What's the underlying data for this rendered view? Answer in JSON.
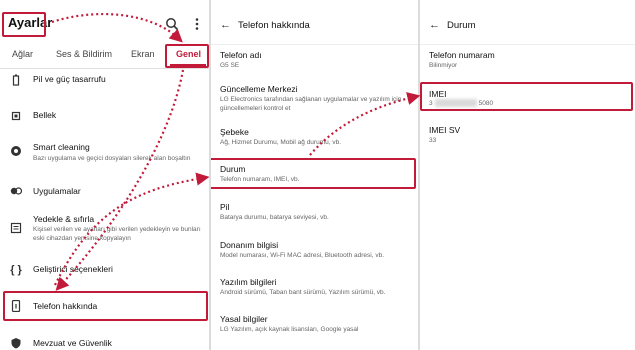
{
  "panel1": {
    "title": "Ayarlar",
    "search_icon": "search-icon",
    "menu_icon": "more-vert-icon",
    "tabs": [
      "Ağlar",
      "Ses & Bildirim",
      "Ekran",
      "Genel"
    ],
    "active_tab": "Genel",
    "items": [
      {
        "icon": "battery-icon",
        "label": "Pil ve güç tasarrufu",
        "sub": ""
      },
      {
        "icon": "memory-icon",
        "label": "Bellek",
        "sub": ""
      },
      {
        "icon": "cleaning-icon",
        "label": "Smart cleaning",
        "sub": "Bazı uygulama ve geçici dosyaları silerek alan boşaltın"
      },
      {
        "icon": "apps-icon",
        "label": "Uygulamalar",
        "sub": ""
      },
      {
        "icon": "backup-icon",
        "label": "Yedekle & sıfırla",
        "sub": "Kişisel verilen ve ayarları gibi verilen yedekleyin ve bunları eski cihazdan yenisine kopyalayın"
      },
      {
        "icon": "developer-icon",
        "label": "Geliştirici seçenekleri",
        "sub": ""
      },
      {
        "icon": "phone-info-icon",
        "label": "Telefon hakkında",
        "sub": ""
      },
      {
        "icon": "security-icon",
        "label": "Mevzuat ve Güvenlik",
        "sub": ""
      }
    ]
  },
  "panel2": {
    "title": "Telefon hakkında",
    "rows": [
      {
        "label": "Telefon adı",
        "sub": "G5 SE"
      },
      {
        "label": "Güncelleme Merkezi",
        "sub": "LG Electronics tarafından sağlanan uygulamalar ve yazılım için güncellemeleri kontrol et"
      },
      {
        "label": "Şebeke",
        "sub": "Ağ, Hizmet Durumu, Mobil ağ durumu, vb."
      },
      {
        "label": "Durum",
        "sub": "Telefon numaram, IMEI, vb."
      },
      {
        "label": "Pil",
        "sub": "Batarya durumu, batarya seviyesi, vb."
      },
      {
        "label": "Donanım bilgisi",
        "sub": "Model numarası, Wi-Fi MAC adresi, Bluetooth adresi, vb."
      },
      {
        "label": "Yazılım bilgileri",
        "sub": "Android sürümü, Taban bant sürümü, Yazılım sürümü, vb."
      },
      {
        "label": "Yasal bilgiler",
        "sub": "LG Yazılım, açık kaynak lisansları, Google yasal"
      }
    ]
  },
  "panel3": {
    "title": "Durum",
    "rows": [
      {
        "label": "Telefon numaram",
        "sub": "Bilinmiyor"
      },
      {
        "label": "IMEI",
        "sub_start": "3",
        "sub_end": "5080"
      },
      {
        "label": "IMEI SV",
        "sub": "33"
      }
    ]
  },
  "colors": {
    "accent": "#c21b3a",
    "highlight": "#c21b3a"
  }
}
